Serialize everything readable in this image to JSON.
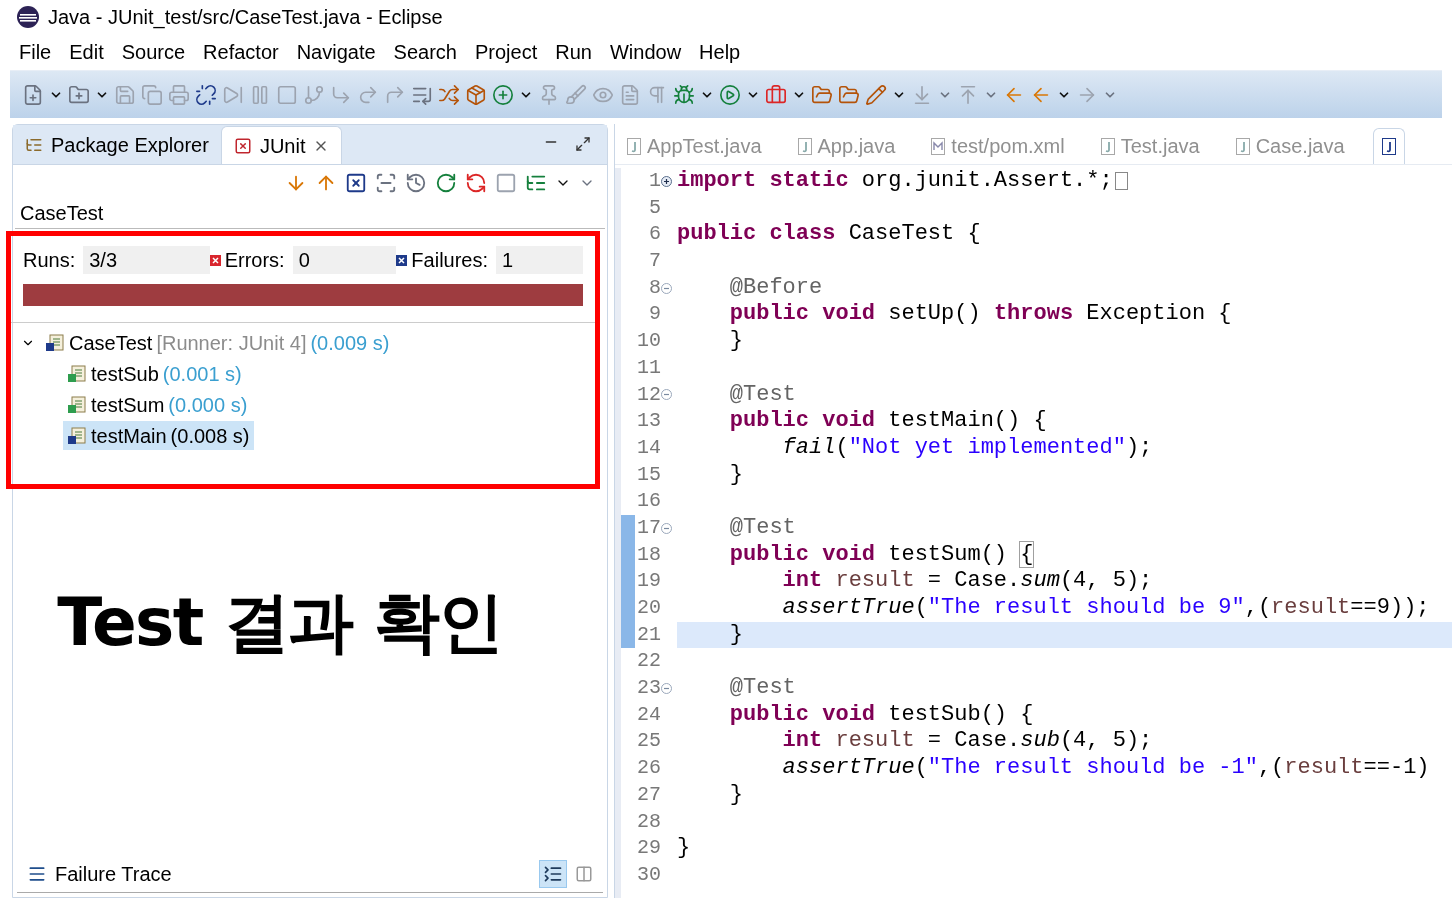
{
  "window": {
    "title": "Java - JUnit_test/src/CaseTest.java - Eclipse"
  },
  "menu": [
    "File",
    "Edit",
    "Source",
    "Refactor",
    "Navigate",
    "Search",
    "Project",
    "Run",
    "Window",
    "Help"
  ],
  "view_tabs": [
    {
      "label": "Package Explorer",
      "selected": false
    },
    {
      "label": "JUnit",
      "selected": true
    }
  ],
  "junit": {
    "title": "CaseTest",
    "counters": [
      {
        "kind": "runs",
        "label": "Runs:",
        "value": "3/3"
      },
      {
        "kind": "errors",
        "label": "Errors:",
        "value": "0"
      },
      {
        "kind": "failures",
        "label": "Failures:",
        "value": "1"
      }
    ],
    "progress": {
      "level": 1,
      "failed": true
    },
    "tree": [
      {
        "name": "CaseTest",
        "runner": "[Runner: JUnit 4]",
        "time": "(0.009 s)",
        "kind": "suite",
        "expanded": true,
        "selected": false,
        "children": [
          {
            "name": "testSub",
            "time": "(0.001 s)",
            "kind": "passed",
            "selected": false
          },
          {
            "name": "testSum",
            "time": "(0.000 s)",
            "kind": "passed",
            "selected": false
          },
          {
            "name": "testMain",
            "time": "(0.008 s)",
            "kind": "failed",
            "selected": true
          }
        ]
      }
    ],
    "failure_trace": {
      "title": "Failure Trace"
    }
  },
  "annotation": {
    "text": "Test 결과 확인"
  },
  "editor_tabs": [
    {
      "label": "AppTest.java",
      "kind": "java",
      "selected": false
    },
    {
      "label": "App.java",
      "kind": "java",
      "selected": false
    },
    {
      "label": "test/pom.xml",
      "kind": "maven",
      "selected": false
    },
    {
      "label": "Test.java",
      "kind": "java",
      "selected": false
    },
    {
      "label": "Case.java",
      "kind": "java",
      "selected": false
    },
    {
      "kind": "java",
      "selected": true
    }
  ],
  "code": [
    {
      "number": "1",
      "kind": "expandable",
      "folded": true,
      "changed": false,
      "highlighted": false,
      "tokens": [
        {
          "kind": "keyword",
          "text": "import static"
        },
        {
          "kind": "plain",
          "text": " org.junit.Assert.*;"
        }
      ]
    },
    {
      "number": "5",
      "changed": false,
      "highlighted": false
    },
    {
      "number": "6",
      "changed": false,
      "highlighted": false,
      "tokens": [
        {
          "kind": "keyword",
          "text": "public class"
        },
        {
          "kind": "plain",
          "text": " CaseTest {"
        }
      ]
    },
    {
      "number": "7",
      "changed": false,
      "highlighted": false
    },
    {
      "number": "8",
      "kind": "collapsible",
      "changed": false,
      "highlighted": false,
      "tokens": [
        {
          "kind": "annotation",
          "text": "    @Before"
        }
      ]
    },
    {
      "number": "9",
      "changed": false,
      "highlighted": false,
      "tokens": [
        {
          "kind": "keyword",
          "text": "    public void"
        },
        {
          "kind": "plain",
          "text": " setUp() "
        },
        {
          "kind": "keyword",
          "text": "throws"
        },
        {
          "kind": "plain",
          "text": " Exception {"
        }
      ]
    },
    {
      "number": "10",
      "changed": false,
      "highlighted": false,
      "tokens": [
        {
          "kind": "plain",
          "text": "    }"
        }
      ]
    },
    {
      "number": "11",
      "changed": false,
      "highlighted": false
    },
    {
      "number": "12",
      "kind": "collapsible",
      "changed": false,
      "highlighted": false,
      "tokens": [
        {
          "kind": "annotation",
          "text": "    @Test"
        }
      ]
    },
    {
      "number": "13",
      "changed": false,
      "highlighted": false,
      "tokens": [
        {
          "kind": "keyword",
          "text": "    public void"
        },
        {
          "kind": "plain",
          "text": " testMain() {"
        }
      ]
    },
    {
      "number": "14",
      "changed": false,
      "highlighted": false,
      "tokens": [
        {
          "kind": "italic",
          "text": "        fail"
        },
        {
          "kind": "plain",
          "text": "("
        },
        {
          "kind": "string",
          "text": "\"Not yet implemented\""
        },
        {
          "kind": "plain",
          "text": ");"
        }
      ]
    },
    {
      "number": "15",
      "changed": false,
      "highlighted": false,
      "tokens": [
        {
          "kind": "plain",
          "text": "    }"
        }
      ]
    },
    {
      "number": "16",
      "changed": false,
      "highlighted": false
    },
    {
      "number": "17",
      "kind": "collapsible",
      "changed": true,
      "highlighted": false,
      "tokens": [
        {
          "kind": "annotation",
          "text": "    @Test"
        }
      ]
    },
    {
      "number": "18",
      "changed": true,
      "highlighted": false,
      "tokens": [
        {
          "kind": "keyword",
          "text": "    public void"
        },
        {
          "kind": "plain",
          "text": " testSum() "
        },
        {
          "kind": "bracket",
          "text": "{"
        }
      ]
    },
    {
      "number": "19",
      "changed": true,
      "highlighted": false,
      "tokens": [
        {
          "kind": "keyword",
          "text": "        int"
        },
        {
          "kind": "local",
          "text": " result"
        },
        {
          "kind": "plain",
          "text": " = Case."
        },
        {
          "kind": "italic",
          "text": "sum"
        },
        {
          "kind": "plain",
          "text": "(4, 5);"
        }
      ]
    },
    {
      "number": "20",
      "changed": true,
      "highlighted": false,
      "tokens": [
        {
          "kind": "italic",
          "text": "        assertTrue"
        },
        {
          "kind": "plain",
          "text": "("
        },
        {
          "kind": "string",
          "text": "\"The result should be 9\""
        },
        {
          "kind": "plain",
          "text": ",("
        },
        {
          "kind": "local",
          "text": "result"
        },
        {
          "kind": "plain",
          "text": "==9));"
        }
      ]
    },
    {
      "number": "21",
      "changed": true,
      "highlighted": true,
      "tokens": [
        {
          "kind": "plain",
          "text": "    }"
        }
      ]
    },
    {
      "number": "22",
      "changed": false,
      "highlighted": false
    },
    {
      "number": "23",
      "kind": "collapsible",
      "changed": false,
      "highlighted": false,
      "tokens": [
        {
          "kind": "annotation",
          "text": "    @Test"
        }
      ]
    },
    {
      "number": "24",
      "changed": false,
      "highlighted": false,
      "tokens": [
        {
          "kind": "keyword",
          "text": "    public void"
        },
        {
          "kind": "plain",
          "text": " testSub() {"
        }
      ]
    },
    {
      "number": "25",
      "changed": false,
      "highlighted": false,
      "tokens": [
        {
          "kind": "keyword",
          "text": "        int"
        },
        {
          "kind": "local",
          "text": " result"
        },
        {
          "kind": "plain",
          "text": " = Case."
        },
        {
          "kind": "italic",
          "text": "sub"
        },
        {
          "kind": "plain",
          "text": "(4, 5);"
        }
      ]
    },
    {
      "number": "26",
      "changed": false,
      "highlighted": false,
      "tokens": [
        {
          "kind": "italic",
          "text": "        assertTrue"
        },
        {
          "kind": "plain",
          "text": "("
        },
        {
          "kind": "string",
          "text": "\"The result should be -1\""
        },
        {
          "kind": "plain",
          "text": ",("
        },
        {
          "kind": "local",
          "text": "result"
        },
        {
          "kind": "plain",
          "text": "==-1)"
        }
      ]
    },
    {
      "number": "27",
      "changed": false,
      "highlighted": false,
      "tokens": [
        {
          "kind": "plain",
          "text": "    }"
        }
      ]
    },
    {
      "number": "28",
      "changed": false,
      "highlighted": false
    },
    {
      "number": "29",
      "changed": false,
      "highlighted": false,
      "tokens": [
        {
          "kind": "plain",
          "text": "}"
        }
      ]
    },
    {
      "number": "30",
      "changed": false,
      "highlighted": false
    }
  ]
}
